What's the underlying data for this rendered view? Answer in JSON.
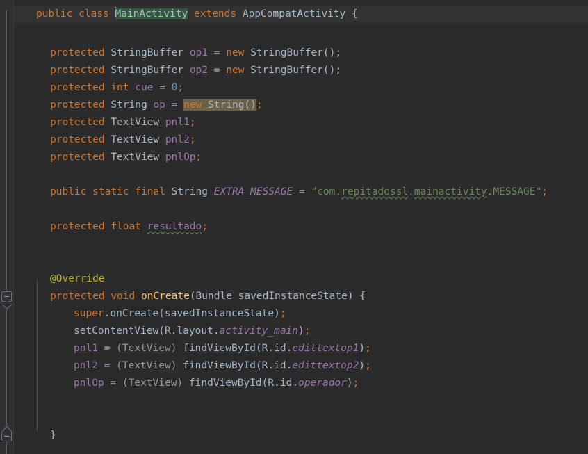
{
  "editor": {
    "theme": "darcula",
    "background_color": "#2b2b2b",
    "current_line_color": "#323232",
    "gutter_color": "#2f3133",
    "font_size_px": 14.5,
    "line_height_px": 25
  },
  "colors": {
    "keyword": "#cc7832",
    "identifier": "#a9b7c6",
    "field": "#9876aa",
    "number": "#6897bb",
    "string": "#6a8759",
    "annotation": "#bbb529",
    "method": "#ffc66d",
    "cast_grey": "#9a9a9a",
    "caret_identifier_highlight": "#32593d",
    "usage_highlight": "#6b6247"
  },
  "gutter": {
    "fold_markers": [
      {
        "name": "fold-marker-oncreate",
        "state": "expanded",
        "glyph": "minus",
        "direction": "down"
      },
      {
        "name": "fold-marker-class-end",
        "state": "expanded",
        "glyph": "minus",
        "direction": "up"
      }
    ]
  },
  "code": {
    "line1": {
      "kw_public": "public",
      "sp1": " ",
      "kw_class": "class",
      "sp2": " ",
      "name_main_activity": "MainActivity",
      "sp3": " ",
      "kw_extends": "extends",
      "sp4": " ",
      "type_appcompat": "AppCompatActivity",
      "brace": " {"
    },
    "line_op1": {
      "kw": "protected",
      "type": "StringBuffer",
      "field": "op1",
      "eq": "=",
      "kw_new": "new",
      "ctor": "StringBuffer();"
    },
    "line_op2": {
      "kw": "protected",
      "type": "StringBuffer",
      "field": "op2",
      "eq": "=",
      "kw_new": "new",
      "ctor": "StringBuffer();"
    },
    "line_cue": {
      "kw": "protected",
      "kw_int": "int",
      "field": "cue",
      "eq": "=",
      "value": "0",
      "semi": ";"
    },
    "line_op": {
      "kw": "protected",
      "type": "String",
      "field": "op",
      "eq": "=",
      "kw_new": "new",
      "ctor": "String()",
      "semi": ";"
    },
    "line_pnl1_decl": {
      "kw": "protected",
      "type": "TextView",
      "field": "pnl1",
      "semi": ";"
    },
    "line_pnl2_decl": {
      "kw": "protected",
      "type": "TextView",
      "field": "pnl2",
      "semi": ";"
    },
    "line_pnlop_decl": {
      "kw": "protected",
      "type": "TextView",
      "field": "pnlOp",
      "semi": ";"
    },
    "line_extra_message": {
      "kw_public": "public",
      "kw_static": "static",
      "kw_final": "final",
      "type": "String",
      "field": "EXTRA_MESSAGE",
      "eq": "=",
      "str_open": "\"com.",
      "str_word1": "repitadossl",
      "str_dot1": ".",
      "str_word2": "mainactivity",
      "str_tail": ".MESSAGE\"",
      "semi": ";"
    },
    "line_resultado": {
      "kw": "protected",
      "kw_float": "float",
      "field": "resultado",
      "semi": ";"
    },
    "line_override": {
      "annotation": "@Override"
    },
    "line_oncreate": {
      "kw": "protected",
      "kw_void": "void",
      "method": "onCreate",
      "paren_open": "(",
      "param_type": "Bundle",
      "param_name": "savedInstanceState",
      "paren_close": ")",
      "brace": " {"
    },
    "line_super": {
      "kw_super": "super",
      "call": ".onCreate(savedInstanceState)",
      "semi": ";"
    },
    "line_setcontentview": {
      "call": "setContentView(R.layout.",
      "res_id": "activity_main",
      "tail": ")",
      "semi": ";"
    },
    "line_pnl1_assign": {
      "field": "pnl1",
      "eq": "=",
      "cast": "(TextView)",
      "call": "findViewById(R.id.",
      "res_id": "edittextop1",
      "tail": ")",
      "semi": ";"
    },
    "line_pnl2_assign": {
      "field": "pnl2",
      "eq": "=",
      "cast": "(TextView)",
      "call": "findViewById(R.id.",
      "res_id": "edittextop2",
      "tail": ")",
      "semi": ";"
    },
    "line_pnlop_assign": {
      "field": "pnlOp",
      "eq": "=",
      "cast": "(TextView)",
      "call": "findViewById(R.id.",
      "res_id": "operador",
      "tail": ")",
      "semi": ";"
    },
    "line_close_brace": {
      "brace": "}"
    }
  }
}
